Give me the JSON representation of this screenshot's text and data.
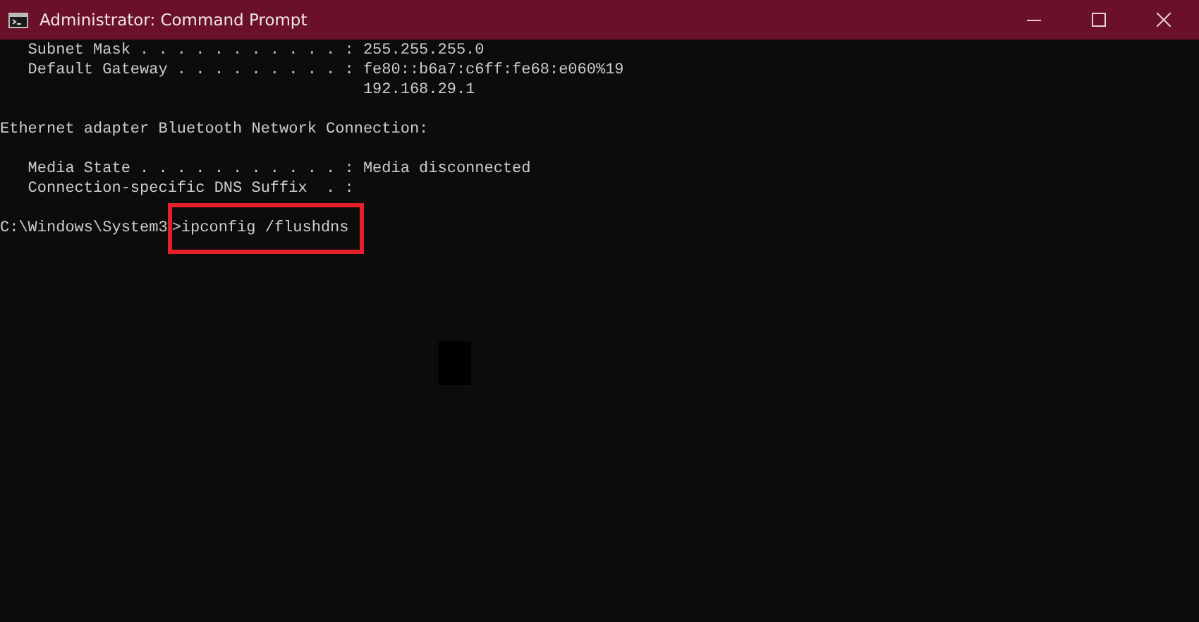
{
  "window": {
    "title": "Administrator: Command Prompt"
  },
  "console": {
    "blocks": [
      {
        "lines": [
          "   Subnet Mask . . . . . . . . . . . : 255.255.255.0",
          "   Default Gateway . . . . . . . . . : fe80::b6a7:c6ff:fe68:e060%19",
          "                                       192.168.29.1"
        ]
      },
      {
        "lines": [
          "Ethernet adapter Bluetooth Network Connection:"
        ]
      },
      {
        "lines": [
          "   Media State . . . . . . . . . . . : Media disconnected",
          "   Connection-specific DNS Suffix  . :"
        ]
      }
    ],
    "prompt": {
      "path": "C:\\Windows\\System3",
      "command": ">ipconfig /flushdns",
      "highlighted": true
    }
  }
}
